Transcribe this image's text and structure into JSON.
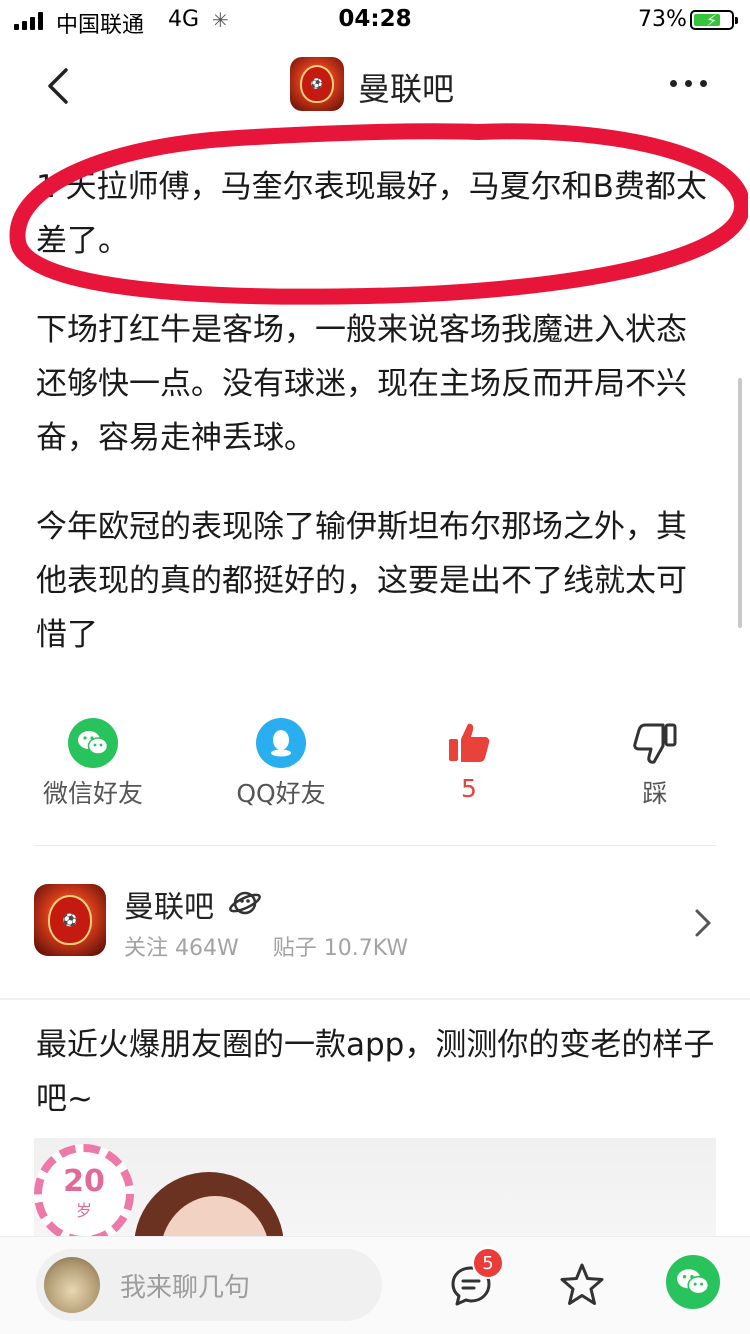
{
  "status_bar": {
    "carrier": "中国联通",
    "network": "4G",
    "time": "04:28",
    "battery_percent": "73%",
    "battery_level": 0.73
  },
  "nav": {
    "title": "曼联吧"
  },
  "post": {
    "paragraphs": [
      "1 天拉师傅，马奎尔表现最好，马夏尔和B费都太差了。",
      "下场打红牛是客场，一般来说客场我魔进入状态还够快一点。没有球迷，现在主场反而开局不兴奋，容易走神丢球。",
      "今年欧冠的表现除了输伊斯坦布尔那场之外，其他表现的真的都挺好的，这要是出不了线就太可惜了"
    ],
    "highlight_color": "#e8153a"
  },
  "share": {
    "wechat_label": "微信好友",
    "qq_label": "QQ好友",
    "like_count": "5",
    "dislike_label": "踩"
  },
  "forum": {
    "name": "曼联吧",
    "follow_label": "关注 464W",
    "posts_label": "贴子 10.7KW"
  },
  "ad": {
    "text": "最近火爆朋友圈的一款app，测测你的变老的样子吧~",
    "age_number": "20",
    "age_unit": "岁"
  },
  "bottom_bar": {
    "comment_placeholder": "我来聊几句",
    "comment_count": "5"
  },
  "colors": {
    "accent_red": "#e8423b",
    "wechat_green": "#29c35e",
    "qq_blue": "#2aaef0"
  }
}
